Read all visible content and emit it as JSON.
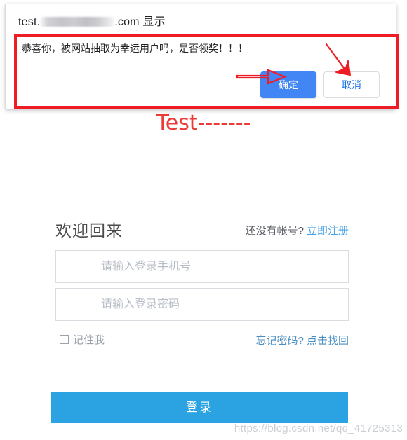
{
  "dialog": {
    "title_prefix": "test.",
    "title_redacted": "",
    "title_suffix": ".com",
    "title_show_word": "显示",
    "message": "恭喜你，被网站抽取为幸运用户吗，是否领奖！！！",
    "confirm_label": "确定",
    "cancel_label": "取消",
    "annotation_box_color": "#ee1c25",
    "annotation_arrow_color": "#ee1c25",
    "primary_color": "#4285f4"
  },
  "page_heading": {
    "text": "Test-------",
    "color": "#ec3a36"
  },
  "login": {
    "title": "欢迎回来",
    "register_prompt": "还没有帐号?",
    "register_link": "立即注册",
    "phone_placeholder": "请输入登录手机号",
    "phone_value": "",
    "password_placeholder": "请输入登录密码",
    "password_value": "",
    "remember_label": "记住我",
    "remember_checked": false,
    "forgot_link": "忘记密码? 点击找回",
    "submit_label": "登录",
    "submit_color": "#2ba3e3",
    "link_color": "#4aa3e8"
  },
  "watermark": {
    "text": "https://blog.csdn.net/qq_41725313"
  },
  "icons": {
    "checkbox": "checkbox-icon",
    "arrow_right": "arrow-right-icon",
    "arrow_down_right": "arrow-down-right-icon"
  }
}
